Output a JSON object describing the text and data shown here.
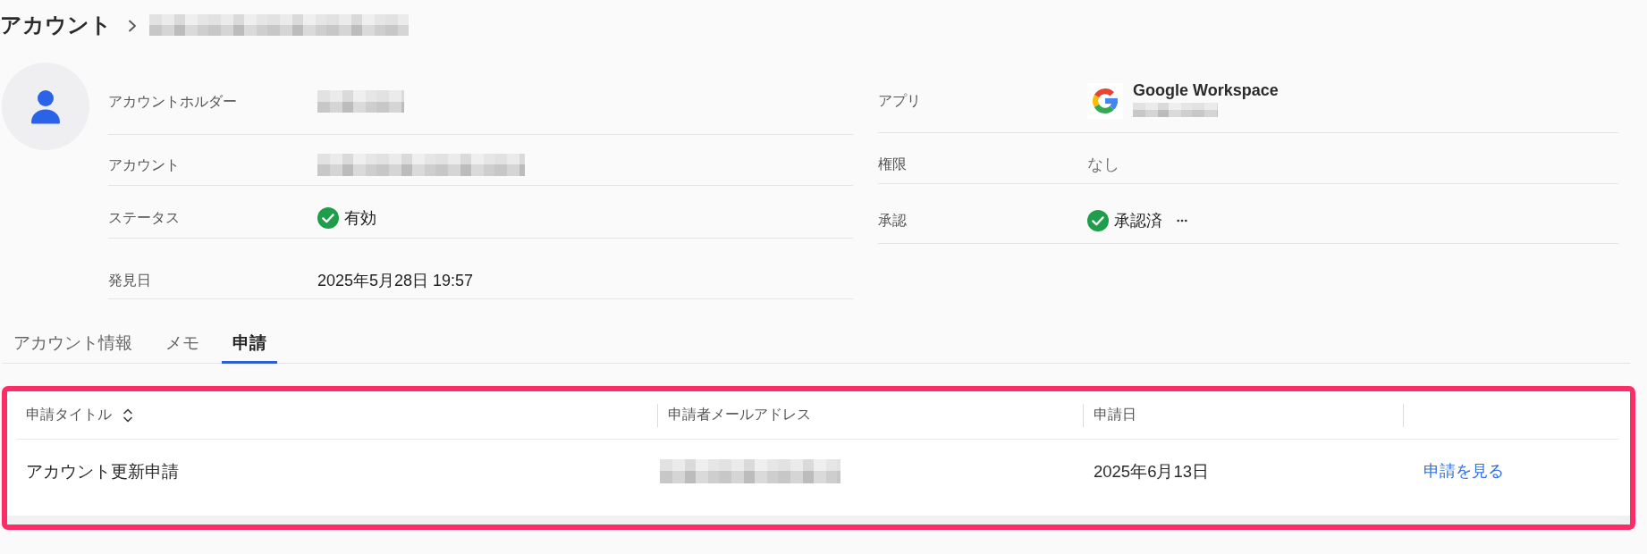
{
  "breadcrumb": {
    "title": "アカウント",
    "current_redacted": true
  },
  "details_left": [
    {
      "kind": "redacted",
      "label": "アカウントホルダー"
    },
    {
      "kind": "redacted",
      "label": "アカウント"
    },
    {
      "kind": "status",
      "label": "ステータス",
      "value": "有効",
      "status_ok": true
    },
    {
      "kind": "text",
      "label": "発見日",
      "value": "2025年5月28日 19:57",
      "muted": false
    }
  ],
  "details_right": [
    {
      "kind": "app",
      "label": "アプリ",
      "name": "Google Workspace",
      "subtitle_redacted": true
    },
    {
      "kind": "text",
      "label": "権限",
      "value": "なし",
      "muted": true
    },
    {
      "kind": "status",
      "label": "承認",
      "value": "承認済",
      "status_ok": true,
      "more": true
    }
  ],
  "tabs": [
    {
      "label": "アカウント情報",
      "selected": false
    },
    {
      "label": "メモ",
      "selected": false
    },
    {
      "label": "申請",
      "selected": true
    }
  ],
  "table": {
    "highlighted": true,
    "columns": [
      {
        "label": "申請タイトル",
        "sortable": true
      },
      {
        "label": "申請者メールアドレス",
        "sortable": false
      },
      {
        "label": "申請日",
        "sortable": false
      }
    ],
    "rows": [
      {
        "cells": [
          {
            "kind": "text",
            "value": "アカウント更新申請"
          },
          {
            "kind": "redacted"
          },
          {
            "kind": "text",
            "value": "2025年6月13日"
          },
          {
            "kind": "link",
            "value": "申請を見る"
          }
        ]
      }
    ]
  }
}
